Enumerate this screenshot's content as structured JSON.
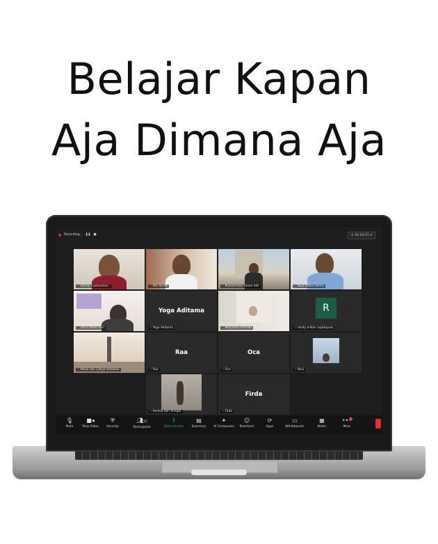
{
  "headline": {
    "line1": "Belajar Kapan",
    "line2": "Aja Dimana Aja"
  },
  "topbar": {
    "recording_label": "Recording...",
    "pause_icon": "pause-icon",
    "stop_icon": "stop-icon",
    "timer": "02:24:51"
  },
  "participants": [
    {
      "name": "Dendy Lustavanov..."
    },
    {
      "name": "IKO ALFIN"
    },
    {
      "name": "Muhammad Fahmi  Adil"
    },
    {
      "name": "Raaf fathia Helmy"
    },
    {
      "name": "Fitria Afifah Sari"
    },
    {
      "name": "Yoga Aditama",
      "display": "Yoga Aditama"
    },
    {
      "name": "Muhjastul Kafindo"
    },
    {
      "name": "randy ardian napitupulu",
      "initial": "R"
    },
    {
      "name": "Nurul Dwi Cahya Irmawan"
    },
    {
      "name": "Raa",
      "display": "Raa"
    },
    {
      "name": "Oca",
      "display": "Oca"
    },
    {
      "name": "Novi"
    },
    {
      "name": "Amelia Sari Siregar"
    },
    {
      "name": "Firda",
      "display": "Firda"
    }
  ],
  "toolbar": {
    "items": [
      {
        "label": "Mute",
        "icon": "mic-icon"
      },
      {
        "label": "Stop Video",
        "icon": "video-icon"
      },
      {
        "label": "Security",
        "icon": "shield-icon"
      },
      {
        "label": "Participants",
        "icon": "participants-icon",
        "count": "16"
      },
      {
        "label": "Share Screen",
        "icon": "share-screen-icon"
      },
      {
        "label": "Summary",
        "icon": "summary-icon"
      },
      {
        "label": "AI Companion",
        "icon": "sparkle-icon"
      },
      {
        "label": "Reactions",
        "icon": "reaction-icon"
      },
      {
        "label": "Apps",
        "icon": "apps-icon"
      },
      {
        "label": "Whiteboards",
        "icon": "whiteboard-icon"
      },
      {
        "label": "Notes",
        "icon": "notes-icon"
      },
      {
        "label": "More",
        "icon": "more-icon",
        "badge": "1"
      }
    ]
  },
  "colors": {
    "active_speaker": "#c9f04a",
    "share_green": "#22c55e",
    "end_red": "#e03131",
    "avatar_bg": "#1f5c45"
  }
}
